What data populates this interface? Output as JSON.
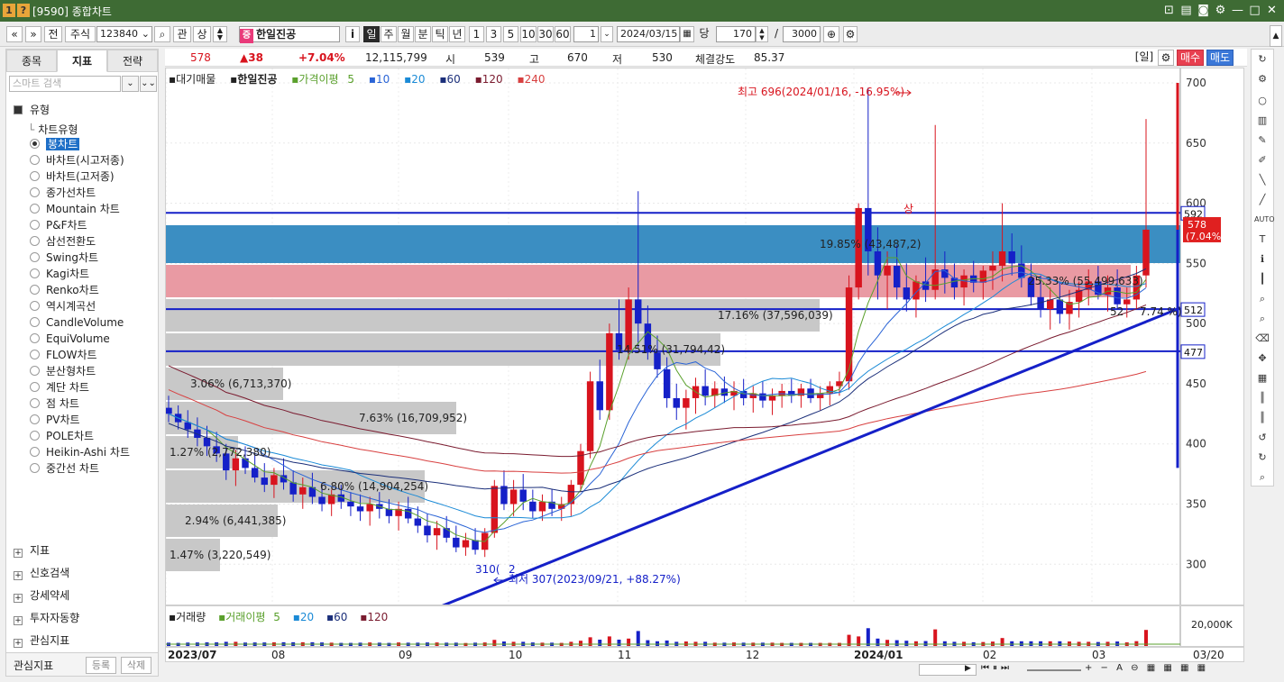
{
  "window": {
    "code": "[9590]",
    "title": "종합차트"
  },
  "toolbar": {
    "nav_back": "«",
    "nav_down": "»",
    "prev_label": "전",
    "market": "주식",
    "stock_code": "123840",
    "gwan": "관",
    "sang": "상",
    "stock_tag": "증",
    "stock_name": "한일진공",
    "info": "i",
    "periods": [
      "일",
      "주",
      "월",
      "분",
      "틱",
      "년"
    ],
    "active_period": "일",
    "minutes": [
      "1",
      "3",
      "5",
      "10",
      "30",
      "60"
    ],
    "unit_value": "1",
    "date": "2024/03/15",
    "count_label": "당",
    "count": "170",
    "slash": "/",
    "max_count": "3000"
  },
  "left_panel": {
    "tabs": [
      "종목",
      "지표",
      "전략"
    ],
    "active_tab": "지표",
    "search_placeholder": "스마트 검색",
    "section_type": "유형",
    "chart_type_label": "차트유형",
    "chart_types": [
      "봉차트",
      "바차트(시고저종)",
      "바차트(고저종)",
      "종가선차트",
      "Mountain 차트",
      "P&F차트",
      "삼선전환도",
      "Swing차트",
      "Kagi차트",
      "Renko차트",
      "역시계곡선",
      "CandleVolume",
      "EquiVolume",
      "FLOW차트",
      "분산형차트",
      "계단 차트",
      "점 차트",
      "PV차트",
      "POLE차트",
      "Heikin-Ashi 차트",
      "중간선 차트"
    ],
    "selected_type": "봉차트",
    "sections": [
      "지표",
      "신호검색",
      "강세약세",
      "투자자동향",
      "관심지표"
    ],
    "footer_label": "관심지표",
    "register": "등록",
    "delete": "삭제"
  },
  "info_row": {
    "price": "578",
    "change": "▲38",
    "pct": "+7.04%",
    "volume": "12,115,799",
    "open_label": "시",
    "open": "539",
    "high_label": "고",
    "high": "670",
    "low_label": "저",
    "low": "530",
    "strength_label": "체결강도",
    "strength": "85.37",
    "period_tag": "[일]",
    "buy": "매수",
    "sell": "매도"
  },
  "legend": {
    "vol_profile": "대기매물",
    "name": "한일진공",
    "ma_label": "가격이평",
    "ma": [
      "5",
      "10",
      "20",
      "60",
      "120",
      "240"
    ]
  },
  "volume_legend": {
    "label": "거래량",
    "ma_label": "거래이평",
    "ma": [
      "5",
      "20",
      "60",
      "120"
    ],
    "axis_label": "20,000K"
  },
  "chart_data": {
    "type": "candlestick",
    "y_ticks": [
      "700",
      "650",
      "600",
      "550",
      "500",
      "450",
      "400",
      "350",
      "300"
    ],
    "x_ticks": [
      "2023/07",
      "08",
      "09",
      "10",
      "11",
      "12",
      "2024/01",
      "02",
      "03"
    ],
    "last_date_label": "03/20",
    "current_price_label": "578",
    "current_pct_label": "(7.04%)",
    "level_labels": [
      "592",
      "512",
      "477"
    ],
    "annotations": {
      "high": "최고 696(2024/01/16, -16.95%)",
      "low": "최저 307(2023/09/21, +88.27%)",
      "sang": "상",
      "low_small": "310(",
      "low_small2": "2",
      "mid": "52",
      "mid_pct": "7.74 %)"
    },
    "volume_profile": [
      {
        "pct": "19.85%",
        "vol": "(43,487,2",
        "suffix": ")"
      },
      {
        "pct": "25.33%",
        "vol": "(55,499,633)"
      },
      {
        "pct": "17.16%",
        "vol": "(37,596,039)"
      },
      {
        "pct": "14.51%",
        "vol": "(31,794,42)"
      },
      {
        "pct": "3.06%",
        "vol": "(6,713,370)"
      },
      {
        "pct": "7.63%",
        "vol": "(16,709,952)"
      },
      {
        "pct": "1.27%",
        "vol": "(2,772,380)"
      },
      {
        "pct": "6.80%",
        "vol": "(14,904,254)"
      },
      {
        "pct": "2.94%",
        "vol": "(6,441,385)"
      },
      {
        "pct": "1.47%",
        "vol": "(3,220,549)"
      }
    ],
    "candles_ohlc": [
      [
        430,
        440,
        418,
        425
      ],
      [
        425,
        432,
        412,
        418
      ],
      [
        418,
        428,
        405,
        412
      ],
      [
        412,
        422,
        398,
        405
      ],
      [
        405,
        415,
        390,
        398
      ],
      [
        398,
        410,
        385,
        392
      ],
      [
        392,
        400,
        370,
        378
      ],
      [
        378,
        395,
        365,
        388
      ],
      [
        388,
        398,
        375,
        380
      ],
      [
        380,
        392,
        368,
        372
      ],
      [
        372,
        384,
        360,
        366
      ],
      [
        366,
        380,
        355,
        374
      ],
      [
        374,
        388,
        362,
        368
      ],
      [
        368,
        378,
        352,
        358
      ],
      [
        358,
        372,
        346,
        364
      ],
      [
        364,
        376,
        350,
        356
      ],
      [
        356,
        368,
        344,
        350
      ],
      [
        350,
        362,
        340,
        358
      ],
      [
        358,
        366,
        346,
        352
      ],
      [
        352,
        360,
        340,
        348
      ],
      [
        348,
        358,
        336,
        344
      ],
      [
        344,
        356,
        332,
        350
      ],
      [
        350,
        360,
        338,
        346
      ],
      [
        346,
        354,
        334,
        340
      ],
      [
        340,
        352,
        328,
        346
      ],
      [
        346,
        356,
        334,
        338
      ],
      [
        338,
        348,
        326,
        332
      ],
      [
        332,
        342,
        318,
        324
      ],
      [
        324,
        336,
        312,
        330
      ],
      [
        330,
        340,
        318,
        322
      ],
      [
        322,
        332,
        310,
        314
      ],
      [
        314,
        326,
        307,
        320
      ],
      [
        320,
        330,
        308,
        312
      ],
      [
        312,
        330,
        306,
        326
      ],
      [
        326,
        370,
        322,
        365
      ],
      [
        365,
        378,
        345,
        350
      ],
      [
        350,
        370,
        340,
        362
      ],
      [
        362,
        375,
        345,
        352
      ],
      [
        352,
        362,
        338,
        344
      ],
      [
        344,
        358,
        336,
        352
      ],
      [
        352,
        362,
        340,
        346
      ],
      [
        346,
        356,
        336,
        350
      ],
      [
        350,
        370,
        340,
        366
      ],
      [
        366,
        400,
        360,
        394
      ],
      [
        394,
        460,
        388,
        452
      ],
      [
        452,
        470,
        420,
        428
      ],
      [
        428,
        500,
        420,
        492
      ],
      [
        492,
        520,
        470,
        478
      ],
      [
        478,
        530,
        470,
        520
      ],
      [
        520,
        610,
        480,
        500
      ],
      [
        500,
        515,
        470,
        476
      ],
      [
        476,
        490,
        455,
        462
      ],
      [
        462,
        472,
        430,
        438
      ],
      [
        438,
        450,
        420,
        430
      ],
      [
        430,
        445,
        412,
        438
      ],
      [
        438,
        455,
        425,
        448
      ],
      [
        448,
        462,
        432,
        440
      ],
      [
        440,
        452,
        430,
        446
      ],
      [
        446,
        456,
        434,
        440
      ],
      [
        440,
        452,
        428,
        444
      ],
      [
        444,
        454,
        432,
        438
      ],
      [
        438,
        448,
        426,
        442
      ],
      [
        442,
        452,
        430,
        436
      ],
      [
        436,
        446,
        424,
        440
      ],
      [
        440,
        450,
        430,
        444
      ],
      [
        444,
        454,
        434,
        440
      ],
      [
        440,
        450,
        430,
        446
      ],
      [
        446,
        454,
        434,
        438
      ],
      [
        438,
        448,
        428,
        442
      ],
      [
        442,
        452,
        432,
        448
      ],
      [
        448,
        460,
        440,
        452
      ],
      [
        452,
        540,
        445,
        530
      ],
      [
        530,
        600,
        520,
        596
      ],
      [
        596,
        696,
        540,
        560
      ],
      [
        560,
        580,
        520,
        540
      ],
      [
        540,
        560,
        512,
        548
      ],
      [
        548,
        565,
        520,
        530
      ],
      [
        530,
        550,
        510,
        520
      ],
      [
        520,
        540,
        505,
        535
      ],
      [
        535,
        555,
        518,
        528
      ],
      [
        528,
        665,
        520,
        545
      ],
      [
        545,
        560,
        525,
        538
      ],
      [
        538,
        550,
        520,
        530
      ],
      [
        530,
        545,
        515,
        540
      ],
      [
        540,
        552,
        526,
        534
      ],
      [
        534,
        548,
        520,
        544
      ],
      [
        544,
        560,
        528,
        548
      ],
      [
        548,
        600,
        535,
        560
      ],
      [
        560,
        575,
        540,
        550
      ],
      [
        550,
        565,
        530,
        538
      ],
      [
        538,
        550,
        515,
        522
      ],
      [
        522,
        540,
        505,
        512
      ],
      [
        512,
        530,
        495,
        520
      ],
      [
        520,
        535,
        500,
        508
      ],
      [
        508,
        528,
        495,
        518
      ],
      [
        518,
        535,
        505,
        528
      ],
      [
        528,
        545,
        515,
        535
      ],
      [
        535,
        548,
        520,
        524
      ],
      [
        524,
        540,
        510,
        530
      ],
      [
        530,
        545,
        512,
        516
      ],
      [
        516,
        530,
        505,
        520
      ],
      [
        520,
        548,
        512,
        540
      ],
      [
        540,
        670,
        530,
        578
      ]
    ]
  }
}
